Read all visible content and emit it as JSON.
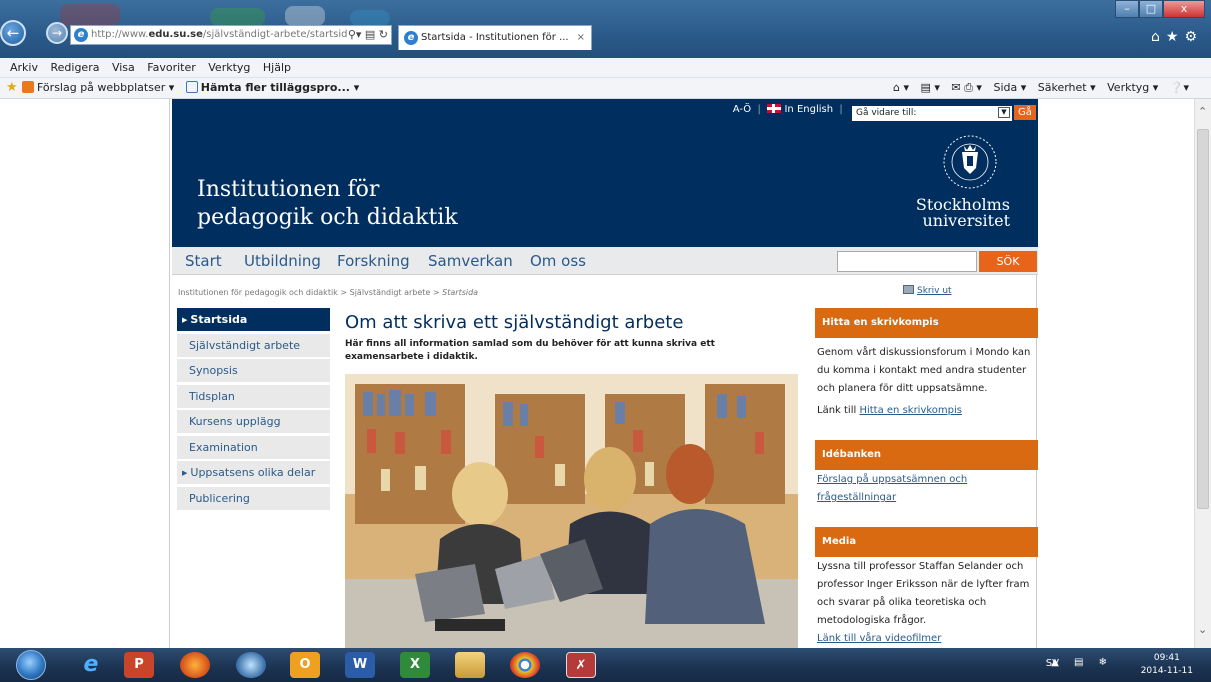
{
  "browser": {
    "address_prefix": "http://www.",
    "address_domain": "edu.su.se",
    "address_path": "/självständigt-arbete/startsid",
    "tab_title": "Startsida - Institutionen för ...",
    "tab_close": "×",
    "menu": [
      "Arkiv",
      "Redigera",
      "Visa",
      "Favoriter",
      "Verktyg",
      "Hjälp"
    ],
    "favorites": {
      "item1": "Förslag på webbplatser ▾",
      "item2": "Hämta fler tilläggspro... ▾"
    },
    "command_bar": [
      "Sida ▾",
      "Säkerhet ▾",
      "Verktyg ▾"
    ],
    "window_controls": [
      "–",
      "□",
      "x"
    ]
  },
  "site": {
    "utility": {
      "a_o": "A-Ö",
      "english": "In English",
      "goto_placeholder": "Gå vidare till:",
      "go_label": "Gå"
    },
    "title_line1": "Institutionen för",
    "title_line2": "pedagogik och didaktik",
    "university_line1": "Stockholms",
    "university_line2": "universitet",
    "nav": [
      "Start",
      "Utbildning",
      "Forskning",
      "Samverkan",
      "Om oss"
    ],
    "search_button": "SÖK",
    "breadcrumb": {
      "part1": "Institutionen för pedagogik och didaktik",
      "sep": " > ",
      "part2": "Självständigt arbete",
      "current": "Startsida"
    },
    "print_label": "Skriv ut",
    "sidenav": [
      {
        "label": "Startsida",
        "active": true,
        "arrow": true
      },
      {
        "label": "Självständigt arbete",
        "active": false,
        "arrow": false
      },
      {
        "label": "Synopsis",
        "active": false,
        "arrow": false
      },
      {
        "label": "Tidsplan",
        "active": false,
        "arrow": false
      },
      {
        "label": "Kursens upplägg",
        "active": false,
        "arrow": false
      },
      {
        "label": "Examination",
        "active": false,
        "arrow": false
      },
      {
        "label": "Uppsatsens olika delar",
        "active": false,
        "arrow": true
      },
      {
        "label": "Publicering",
        "active": false,
        "arrow": false
      }
    ],
    "main": {
      "heading": "Om att skriva ett självständigt arbete",
      "lead": "Här finns all information samlad som du behöver för att kunna skriva ett examensarbete i didaktik."
    },
    "boxes": {
      "skrivkompis": {
        "title": "Hitta en skrivkompis",
        "text": "Genom vårt diskussionsforum i Mondo kan du komma i kontakt med andra studenter och planera för ditt uppsatsämne.",
        "link_prefix": "Länk till",
        "link": "Hitta en skrivkompis"
      },
      "idebanken": {
        "title": "Idébanken",
        "link": "Förslag på uppsatsämnen och frågeställningar"
      },
      "media": {
        "title": "Media",
        "text": "Lyssna till professor Staffan Selander och professor Inger Eriksson när de lyfter fram och svarar på olika teoretiska och metodologiska frågor.",
        "link": "Länk till våra videofilmer"
      }
    }
  },
  "taskbar": {
    "language": "SV",
    "time": "09:41",
    "date": "2014-11-11"
  },
  "colors": {
    "su_blue": "#002f5f",
    "su_orange": "#d96a12",
    "link_blue": "#2a5a8a"
  }
}
